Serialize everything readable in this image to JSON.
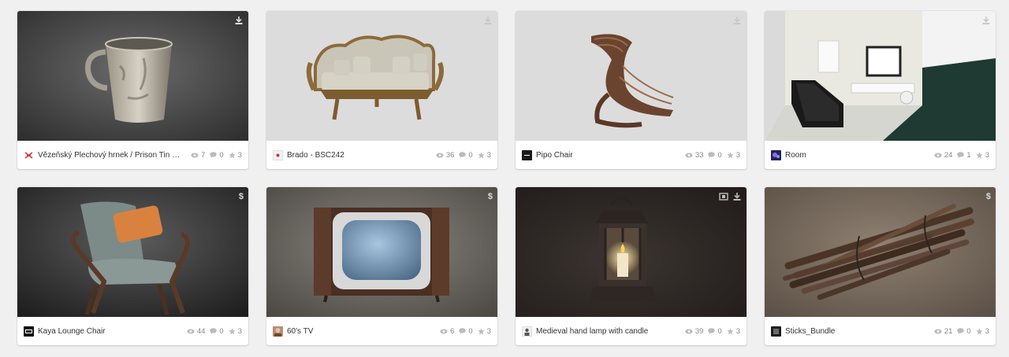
{
  "models": [
    {
      "title": "Vězeňský Plechový hrnek / Prison Tin mug",
      "views": "7",
      "comments": "0",
      "likes": "3",
      "badge": "download-icon",
      "avatar": "crossed-swords-logo"
    },
    {
      "title": "Brado - BSC242",
      "views": "36",
      "comments": "0",
      "likes": "3",
      "badge": "download-icon",
      "avatar": "brado-logo"
    },
    {
      "title": "Pipo Chair",
      "views": "33",
      "comments": "0",
      "likes": "3",
      "badge": "download-icon",
      "avatar": "dark-logo"
    },
    {
      "title": "Room",
      "views": "24",
      "comments": "1",
      "likes": "3",
      "badge": "download-icon",
      "avatar": "purple-avatar"
    },
    {
      "title": "Kaya Lounge Chair",
      "views": "44",
      "comments": "0",
      "likes": "3",
      "badge": "$",
      "avatar": "dark-logo"
    },
    {
      "title": "60's TV",
      "views": "6",
      "comments": "0",
      "likes": "3",
      "badge": "$",
      "avatar": "photo-avatar"
    },
    {
      "title": "Medieval hand lamp with candle",
      "views": "39",
      "comments": "0",
      "likes": "3",
      "badge": "film-and-download-icons",
      "avatar": "figure-avatar"
    },
    {
      "title": "Sticks_Bundle",
      "views": "21",
      "comments": "0",
      "likes": "3",
      "badge": "$",
      "avatar": "dark-logo"
    }
  ],
  "colors": {
    "page_bg": "#f0f0f0",
    "card_bg": "#ffffff",
    "title_text": "#333333",
    "stat_text": "#888888",
    "icon_on_light": "#c8c8c8",
    "icon_on_dark": "#dddddd"
  }
}
